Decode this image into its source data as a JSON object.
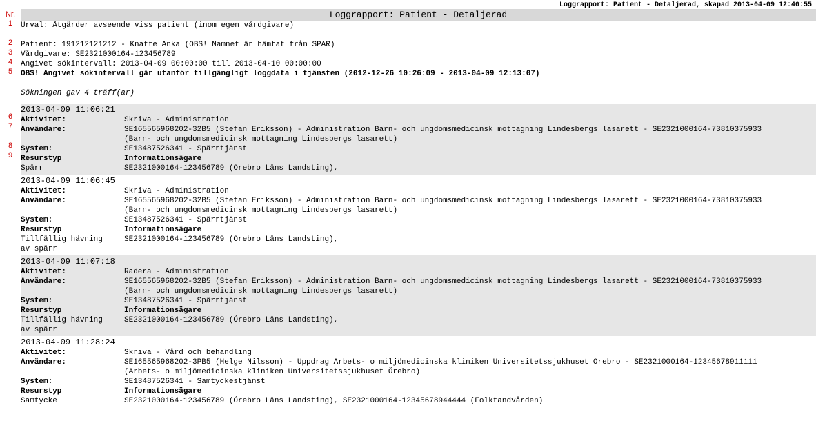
{
  "top_meta": "Loggrapport: Patient - Detaljerad, skapad 2013-04-09 12:40:55",
  "title": "Loggrapport: Patient - Detaljerad",
  "nr_header": "Nr.",
  "header_numbers": [
    "1",
    "2",
    "3",
    "4",
    "5"
  ],
  "header_lines": {
    "urval": "Urval: Åtgärder avseende viss patient (inom egen vårdgivare)",
    "patient": "Patient: 191212121212 - Knatte Anka (OBS! Namnet är hämtat från SPAR)",
    "vardgivare": "Vårdgivare: SE2321000164-123456789",
    "intervall": "Angivet sökintervall: 2013-04-09 00:00:00 till 2013-04-10 00:00:00",
    "obs": "OBS! Angivet sökintervall går utanför tillgängligt loggdata i tjänsten (2012-12-26 10:26:09 - 2013-04-09 12:13:07)"
  },
  "result_count": "Sökningen gav 4 träff(ar)",
  "labels": {
    "aktivitet": "Aktivitet:",
    "anvandare": "Användare:",
    "system": "System:",
    "resurstyp": "Resurstyp",
    "info_agare": "Informationsägare"
  },
  "entry_numbers": [
    "6",
    "7",
    "8",
    "9"
  ],
  "entries": [
    {
      "ts": "2013-04-09 11:06:21",
      "aktivitet": "Skriva - Administration",
      "anvandare_l1": "SE165565968202-32B5 (Stefan Eriksson) - Administration Barn- och ungdomsmedicinsk mottagning Lindesbergs lasarett - SE2321000164-73810375933",
      "anvandare_l2": "(Barn- och ungdomsmedicinsk mottagning Lindesbergs lasarett)",
      "system": "SE13487526341 - Spärrtjänst",
      "resurs_label": "Spärr",
      "resurs_value": "SE2321000164-123456789 (Örebro Läns Landsting),"
    },
    {
      "ts": "2013-04-09 11:06:45",
      "aktivitet": "Skriva - Administration",
      "anvandare_l1": "SE165565968202-32B5 (Stefan Eriksson) - Administration Barn- och ungdomsmedicinsk mottagning Lindesbergs lasarett - SE2321000164-73810375933",
      "anvandare_l2": "(Barn- och ungdomsmedicinsk mottagning Lindesbergs lasarett)",
      "system": "SE13487526341 - Spärrtjänst",
      "resurs_label_l1": "Tillfällig hävning",
      "resurs_label_l2": "av spärr",
      "resurs_value": "SE2321000164-123456789 (Örebro Läns Landsting),"
    },
    {
      "ts": "2013-04-09 11:07:18",
      "aktivitet": "Radera - Administration",
      "anvandare_l1": "SE165565968202-32B5 (Stefan Eriksson) - Administration Barn- och ungdomsmedicinsk mottagning Lindesbergs lasarett - SE2321000164-73810375933",
      "anvandare_l2": "(Barn- och ungdomsmedicinsk mottagning Lindesbergs lasarett)",
      "system": "SE13487526341 - Spärrtjänst",
      "resurs_label_l1": "Tillfällig hävning",
      "resurs_label_l2": "av spärr",
      "resurs_value": "SE2321000164-123456789 (Örebro Läns Landsting),"
    },
    {
      "ts": "2013-04-09 11:28:24",
      "aktivitet": "Skriva - Vård och behandling",
      "anvandare_l1": "SE165565968202-3PB5 (Helge Nilsson) - Uppdrag Arbets- o miljömedicinska kliniken Universitetssjukhuset Örebro - SE2321000164-12345678911111",
      "anvandare_l2": "(Arbets- o miljömedicinska kliniken Universitetssjukhuset Örebro)",
      "system": "SE13487526341 - Samtyckestjänst",
      "resurs_label": "Samtycke",
      "resurs_value": "SE2321000164-123456789 (Örebro Läns Landsting), SE2321000164-12345678944444 (Folktandvården)"
    }
  ]
}
